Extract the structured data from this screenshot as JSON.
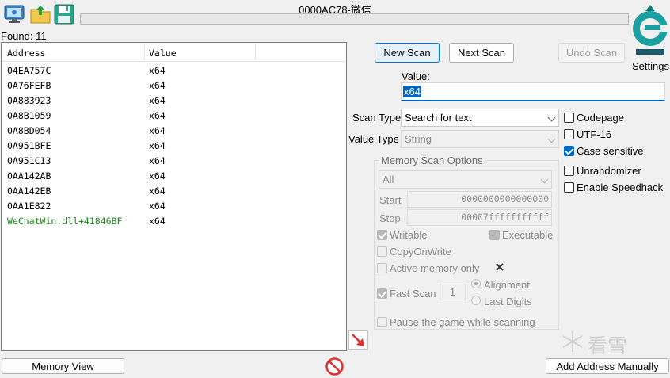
{
  "window": {
    "title": "0000AC78-微信"
  },
  "toolbar": {
    "icons": [
      "open-process-icon",
      "open-file-icon",
      "save-icon"
    ]
  },
  "found": {
    "label": "Found: 11"
  },
  "results": {
    "columns": [
      "Address",
      "Value"
    ],
    "rows": [
      {
        "address": "04EA757C",
        "value": "x64",
        "static": false
      },
      {
        "address": "0A76FEFB",
        "value": "x64",
        "static": false
      },
      {
        "address": "0A883923",
        "value": "x64",
        "static": false
      },
      {
        "address": "0A8B1059",
        "value": "x64",
        "static": false
      },
      {
        "address": "0A8BD054",
        "value": "x64",
        "static": false
      },
      {
        "address": "0A951BFE",
        "value": "x64",
        "static": false
      },
      {
        "address": "0A951C13",
        "value": "x64",
        "static": false
      },
      {
        "address": "0AA142AB",
        "value": "x64",
        "static": false
      },
      {
        "address": "0AA142EB",
        "value": "x64",
        "static": false
      },
      {
        "address": "0AA1E822",
        "value": "x64",
        "static": false
      },
      {
        "address": "WeChatWin.dll+41846BF",
        "value": "x64",
        "static": true
      }
    ],
    "static_color": "#1a8a1a"
  },
  "scan": {
    "new_scan": "New Scan",
    "next_scan": "Next Scan",
    "undo_scan": "Undo Scan",
    "settings": "Settings",
    "value_label": "Value:",
    "value": "x64",
    "scan_type_label": "Scan Type",
    "scan_type": "Search for text",
    "value_type_label": "Value Type",
    "value_type": "String"
  },
  "options": {
    "codepage": {
      "label": "Codepage",
      "checked": false
    },
    "utf16": {
      "label": "UTF-16",
      "checked": false
    },
    "case_sensitive": {
      "label": "Case sensitive",
      "checked": true
    },
    "unrandomizer": {
      "label": "Unrandomizer",
      "checked": false
    },
    "speedhack": {
      "label": "Enable Speedhack",
      "checked": false
    }
  },
  "memory_scan": {
    "title": "Memory Scan Options",
    "region": "All",
    "start_label": "Start",
    "start": "0000000000000000",
    "stop_label": "Stop",
    "stop": "00007fffffffffff",
    "writable": "Writable",
    "executable": "Executable",
    "copy_on_write": "CopyOnWrite",
    "active_memory": "Active memory only",
    "fast_scan": "Fast Scan",
    "fast_scan_value": "1",
    "alignment": "Alignment",
    "last_digits": "Last Digits",
    "pause_game": "Pause the game while scanning"
  },
  "bottom": {
    "memory_view": "Memory View",
    "add_address": "Add Address Manually"
  },
  "watermark": {
    "text": "看雪"
  },
  "colors": {
    "accent": "#0078d7",
    "selection": "#0067c0",
    "logo": "#1aa0a0"
  }
}
